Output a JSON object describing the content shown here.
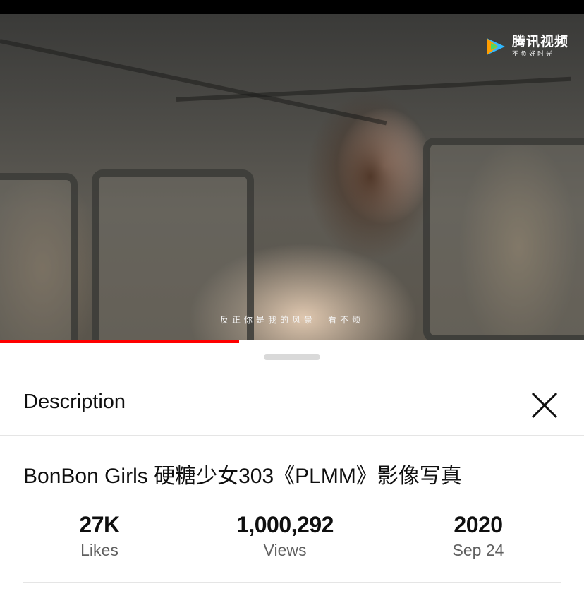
{
  "video": {
    "watermark_title": "腾讯视频",
    "watermark_subtitle": "不负好时光",
    "subtitle_text": "反正你是我的风景　看不烦",
    "progress_fraction": 0.41,
    "progress_color": "#ff0000"
  },
  "panel": {
    "title": "Description",
    "close_icon": "close-icon"
  },
  "description": {
    "video_title": "BonBon Girls 硬糖少女303《PLMM》影像写真",
    "stats": [
      {
        "value": "27K",
        "label": "Likes"
      },
      {
        "value": "1,000,292",
        "label": "Views"
      },
      {
        "value": "2020",
        "label": "Sep 24"
      }
    ]
  }
}
